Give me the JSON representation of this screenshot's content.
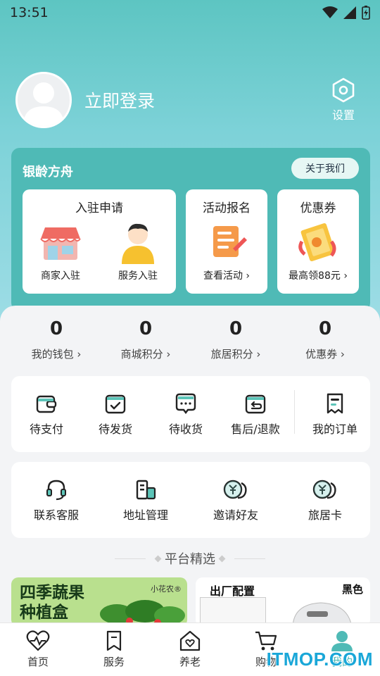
{
  "status_bar": {
    "time": "13:51"
  },
  "profile": {
    "login_label": "立即登录",
    "settings_label": "设置"
  },
  "ark": {
    "title": "银龄方舟",
    "about_label": "关于我们",
    "apply": {
      "title": "入驻申请",
      "items": [
        {
          "label": "商家入驻"
        },
        {
          "label": "服务入驻"
        }
      ]
    },
    "activity": {
      "title": "活动报名",
      "link": "查看活动"
    },
    "coupon": {
      "title": "优惠券",
      "link": "最高领88元"
    }
  },
  "stats": [
    {
      "value": "0",
      "label": "我的钱包"
    },
    {
      "value": "0",
      "label": "商城积分"
    },
    {
      "value": "0",
      "label": "旅居积分"
    },
    {
      "value": "0",
      "label": "优惠券"
    }
  ],
  "orders": [
    {
      "label": "待支付",
      "icon": "wallet-icon"
    },
    {
      "label": "待发货",
      "icon": "box-check-icon"
    },
    {
      "label": "待收货",
      "icon": "chat-bubble-icon"
    },
    {
      "label": "售后/退款",
      "icon": "refund-box-icon"
    },
    {
      "label": "我的订单",
      "icon": "receipt-icon"
    }
  ],
  "services": [
    {
      "label": "联系客服",
      "icon": "headset-icon"
    },
    {
      "label": "地址管理",
      "icon": "building-icon"
    },
    {
      "label": "邀请好友",
      "icon": "coins-icon"
    },
    {
      "label": "旅居卡",
      "icon": "coins-icon"
    }
  ],
  "section_title": "平台精选",
  "promos": [
    {
      "title_line1": "四季蔬果",
      "title_line2": "种植盒",
      "brand": "小花农®"
    },
    {
      "title": "出厂配置",
      "tag": "黑色"
    }
  ],
  "nav": [
    {
      "label": "首页",
      "icon": "heartbeat-icon"
    },
    {
      "label": "服务",
      "icon": "bookmark-icon"
    },
    {
      "label": "养老",
      "icon": "house-heart-icon"
    },
    {
      "label": "购物",
      "icon": "cart-icon"
    },
    {
      "label": "我的",
      "icon": "person-icon"
    }
  ],
  "watermark": "ITMOP.COM",
  "colors": {
    "teal": "#4fbab6",
    "header_gradient_top": "#5dc5c2",
    "accent_blue": "#1aa7d8"
  }
}
